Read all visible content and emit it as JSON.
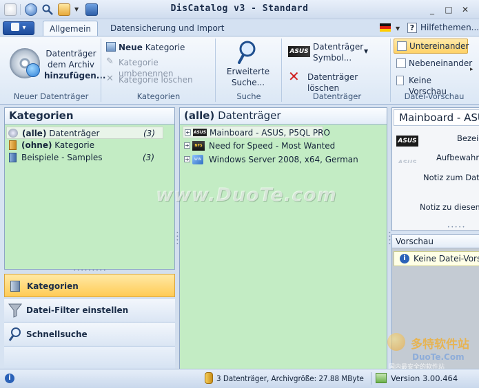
{
  "window": {
    "title": "DisCatalog v3 - Standard",
    "controls": {
      "minimize": "_",
      "maximize": "□",
      "close": "✕"
    }
  },
  "ribbon": {
    "app_button": "▾",
    "tabs": [
      {
        "label": "Allgemein",
        "active": true
      },
      {
        "label": "Datensicherung und Import",
        "active": false
      }
    ],
    "help_label": "Hilfethemen...",
    "help_icon": "?",
    "groups": {
      "neuer_datentraeger": {
        "label": "Neuer Datenträger",
        "button_line1": "Datenträger",
        "button_line2": "dem Archiv",
        "button_line3": "hinzufügen..."
      },
      "kategorien": {
        "label": "Kategorien",
        "new_bold": "Neue",
        "new_rest": " Kategorie",
        "rename": "Kategorie umbenennen",
        "delete": "Kategorie löschen"
      },
      "suche": {
        "label": "Suche",
        "button_line1": "Erweiterte",
        "button_line2": "Suche..."
      },
      "datentraeger": {
        "label": "Datenträger",
        "symbol_line1": "Datenträger",
        "symbol_line2": "Symbol...",
        "delete": "Datenträger löschen",
        "brand": "ASUS"
      },
      "datei_vorschau": {
        "label": "Datei-Vorschau",
        "option1": "Untereinander",
        "option2": "Nebeneinander",
        "option3": "Keine Vorschau"
      }
    }
  },
  "kategorien_panel": {
    "title": "Kategorien",
    "items": [
      {
        "bold": "(alle)",
        "label": "Datenträger",
        "count": "(3)"
      },
      {
        "bold": "(ohne)",
        "label": "Kategorie",
        "count": ""
      },
      {
        "bold": "",
        "label": "Beispiele - Samples",
        "count": "(3)"
      }
    ]
  },
  "nav": {
    "kategorien": "Kategorien",
    "filter": "Datei-Filter einstellen",
    "schnellsuche": "Schnellsuche"
  },
  "datentraeger_panel": {
    "title_bold": "(alle)",
    "title_rest": " Datenträger",
    "items": [
      {
        "label": "Mainboard - ASUS, P5QL PRO",
        "icon": "ASUS",
        "expand": "+"
      },
      {
        "label": "Need for Speed - Most Wanted",
        "icon": "NFS",
        "expand": "+"
      },
      {
        "label": "Windows Server 2008, x64, German",
        "icon": "WIN",
        "expand": "+"
      }
    ]
  },
  "details_panel": {
    "title": "Mainboard - ASUS",
    "field1": "Bezeic",
    "field2": "Aufbewahru",
    "field3": "Notiz zum Date",
    "field4": "Notiz zu diesem C",
    "brand": "ASUS"
  },
  "vorschau_panel": {
    "title": "Vorschau",
    "message": "Keine  Datei-Vorsc"
  },
  "watermark": {
    "text": "www.DuoTe.com",
    "site_cn": "多特软件站",
    "site_en": "DuoTe.Com",
    "sub": "国内最安全的软件站"
  },
  "status": {
    "info": "3 Datenträger, Archivgröße: 27.88 MByte",
    "version": "Version 3.00.464"
  }
}
